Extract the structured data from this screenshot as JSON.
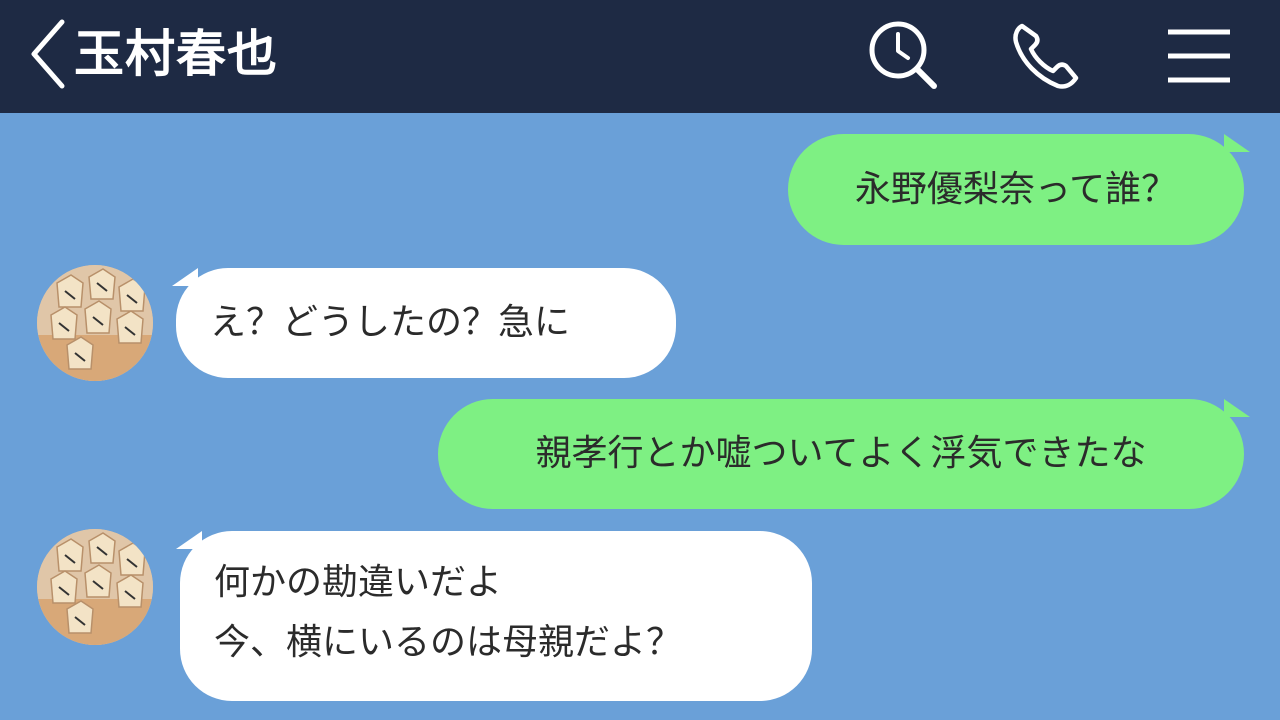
{
  "header": {
    "contact_name": "玉村春也",
    "icons": [
      "back-icon",
      "search-history-icon",
      "phone-icon",
      "menu-icon"
    ]
  },
  "messages": [
    {
      "side": "out",
      "text": "永野優梨奈って誰？"
    },
    {
      "side": "in",
      "text": "え？どうしたの？急に"
    },
    {
      "side": "out",
      "text": "親孝行とか嘘ついてよく浮気できたな"
    },
    {
      "side": "in",
      "lines": [
        "何かの勘違いだよ",
        "今、横にいるのは母親だよ？"
      ]
    }
  ],
  "colors": {
    "header_bg": "#1e2a44",
    "chat_bg": "#6aa0d8",
    "outgoing_bubble": "#7ef083",
    "incoming_bubble": "#ffffff"
  }
}
